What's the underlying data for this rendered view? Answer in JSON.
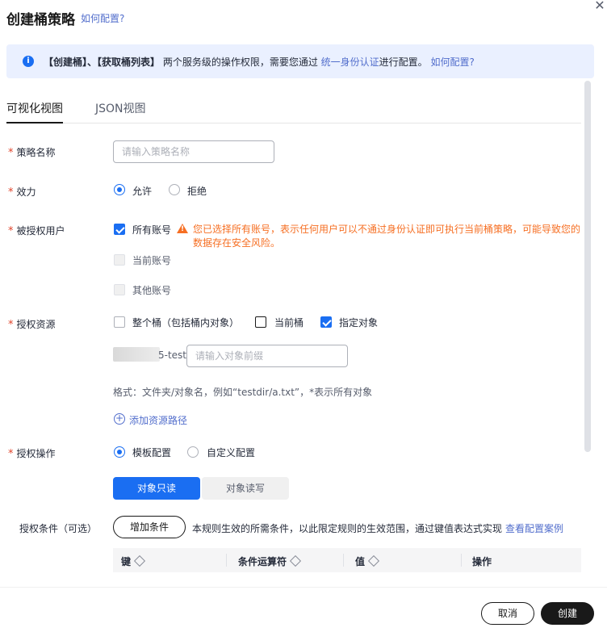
{
  "dialog": {
    "title": "创建桶策略",
    "help_link": "如何配置?",
    "close_icon": "close-icon"
  },
  "info_banner": {
    "part1": "【创建桶】、【获取桶列表】",
    "part2": " 两个服务级的操作权限，需要您通过 ",
    "iam_link": "统一身份认证",
    "part3": "进行配置。 ",
    "help_link": "如何配置?"
  },
  "tabs": [
    {
      "label": "可视化视图",
      "active": true
    },
    {
      "label": "JSON视图",
      "active": false
    }
  ],
  "form": {
    "policy_name": {
      "label": "策略名称",
      "placeholder": "请输入策略名称"
    },
    "effect": {
      "label": "效力",
      "options": [
        "允许",
        "拒绝"
      ],
      "selected": "允许"
    },
    "principal": {
      "label": "被授权用户",
      "options": [
        {
          "label": "所有账号",
          "checked": true,
          "disabled": false
        },
        {
          "label": "当前账号",
          "checked": false,
          "disabled": true
        },
        {
          "label": "其他账号",
          "checked": false,
          "disabled": true
        }
      ],
      "warning": "您已选择所有账号，表示任何用户可以不通过身份认证即可执行当前桶策略，可能导致您的数据存在安全风险。"
    },
    "resource": {
      "label": "授权资源",
      "options": [
        {
          "label": "整个桶（包括桶内对象）",
          "checked": false
        },
        {
          "label": "当前桶",
          "checked": false
        },
        {
          "label": "指定对象",
          "checked": true
        }
      ],
      "bucket_suffix": "5-test",
      "object_placeholder": "请输入对象前缀",
      "format_hint": "格式：文件夹/对象名，例如“testdir/a.txt”，*表示所有对象",
      "add_path": "添加资源路径"
    },
    "actions": {
      "label": "授权操作",
      "options": [
        "模板配置",
        "自定义配置"
      ],
      "selected": "模板配置",
      "templates": [
        "对象只读",
        "对象读写"
      ],
      "active_template": "对象只读"
    },
    "conditions": {
      "label": "授权条件（可选）",
      "add_button": "增加条件",
      "description": "本规则生效的所需条件，以此限定规则的生效范围，通过键值表达式实现",
      "example_link": "查看配置案例",
      "columns": [
        "键",
        "条件运算符",
        "值",
        "操作"
      ]
    }
  },
  "footer": {
    "cancel": "取消",
    "create": "创建"
  },
  "colors": {
    "accent": "#1a6ef2",
    "link": "#526ecc",
    "warning": "#f66f23",
    "required": "#e0442b"
  }
}
